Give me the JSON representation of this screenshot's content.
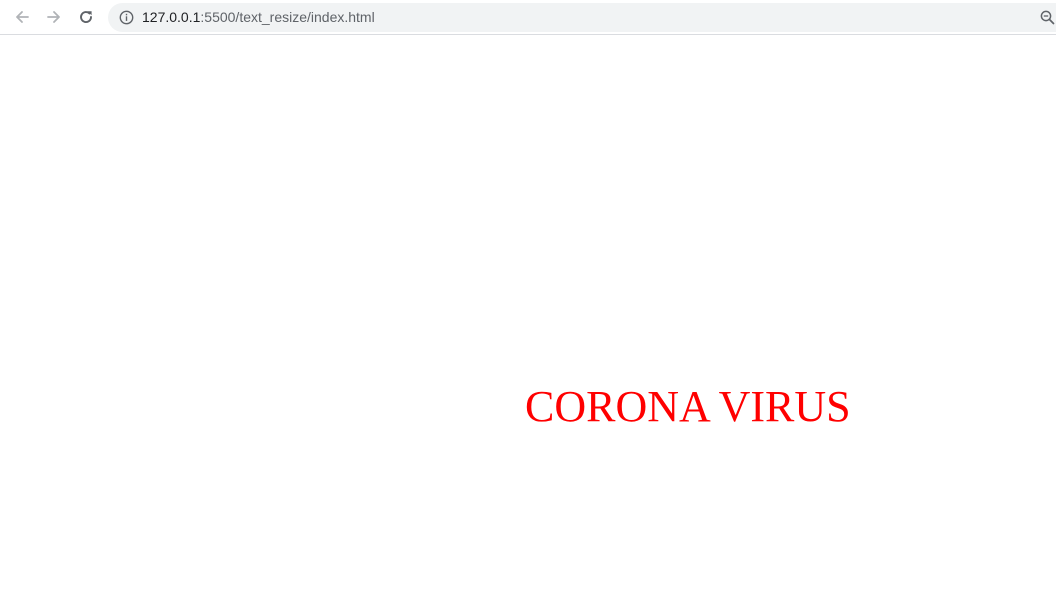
{
  "browser": {
    "url_host": "127.0.0.1",
    "url_rest": ":5500/text_resize/index.html",
    "back_icon": "arrow-left-icon",
    "forward_icon": "arrow-right-icon",
    "reload_icon": "reload-icon",
    "info_icon": "info-icon",
    "zoom_icon": "zoom-icon"
  },
  "page": {
    "headline": "CORONA VIRUS",
    "headline_color": "#ff0000"
  }
}
